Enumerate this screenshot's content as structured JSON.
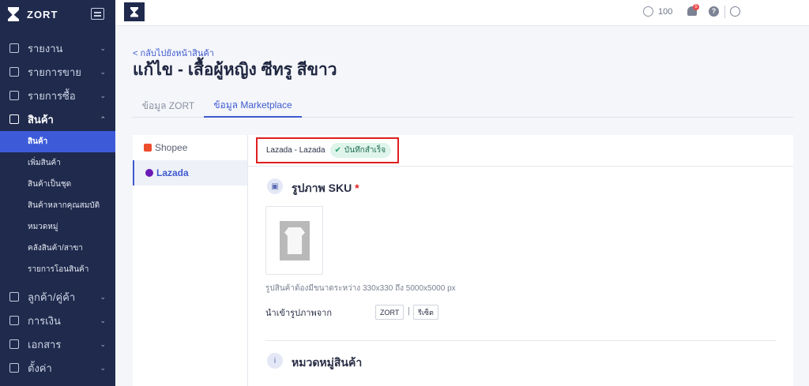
{
  "sidebar": {
    "brand": "ZORT",
    "items": [
      {
        "label": "รายงาน",
        "icon": "chart-icon"
      },
      {
        "label": "รายการขาย",
        "icon": "clipboard-icon"
      },
      {
        "label": "รายการซื้อ",
        "icon": "basket-icon"
      },
      {
        "label": "สินค้า",
        "icon": "box-icon"
      }
    ],
    "sub_items": [
      "สินค้า",
      "เพิ่มสินค้า",
      "สินค้าเป็นชุด",
      "สินค้าหลากคุณสมบัติ",
      "หมวดหมู่",
      "คลังสินค้า/สาขา",
      "รายการโอนสินค้า"
    ],
    "items_bottom": [
      {
        "label": "ลูกค้า/คู่ค้า",
        "icon": "users-icon"
      },
      {
        "label": "การเงิน",
        "icon": "dollar-icon"
      },
      {
        "label": "เอกสาร",
        "icon": "document-icon"
      },
      {
        "label": "ตั้งค่า",
        "icon": "gear-icon"
      }
    ]
  },
  "topbar": {
    "credits": "100",
    "notification_count": "5",
    "help": "?"
  },
  "page": {
    "back_link": "< กลับไปยังหน้าสินค้า",
    "title": "แก้ไข - เสื้อผู้หญิง ซีทรู สีขาว",
    "tabs": [
      "ข้อมูล ZORT",
      "ข้อมูล Marketplace"
    ]
  },
  "marketplaces": [
    "Shopee",
    "Lazada"
  ],
  "status": {
    "label": "Lazada - Lazada",
    "badge": "บันทึกสำเร็จ"
  },
  "sku_section": {
    "title": "รูปภาพ SKU",
    "required": "*",
    "hint": "รูปสินค้าต้องมีขนาดระหว่าง 330x330 ถึง 5000x5000 px",
    "import_label": "นำเข้ารูปภาพจาก",
    "import_buttons": [
      "ZORT",
      "รีเซ็ต"
    ],
    "separator": "|"
  },
  "category_section": {
    "title": "หมวดหมู่สินค้า"
  },
  "colors": {
    "sidebar": "#1f2a4d",
    "accent": "#3f5ad0",
    "success": "#22a06b",
    "highlight_border": "#e01e1e"
  }
}
